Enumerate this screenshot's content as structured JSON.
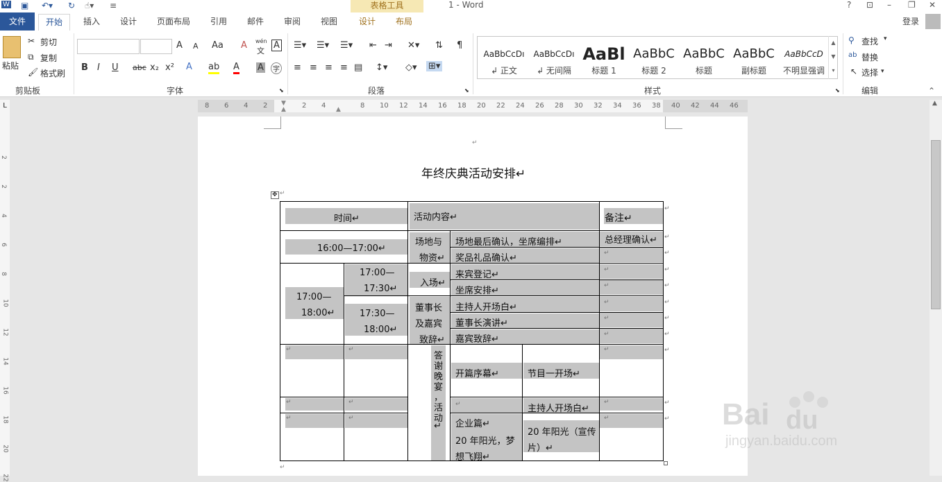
{
  "window": {
    "doc_title": "1 - Word",
    "contextual": "表格工具",
    "help": "?",
    "minimize": "–",
    "restore": "❐",
    "close": "✕",
    "login": "登录"
  },
  "tabs": {
    "file": "文件",
    "home": "开始",
    "insert": "插入",
    "design": "设计",
    "layout": "页面布局",
    "references": "引用",
    "mailings": "邮件",
    "review": "审阅",
    "view": "视图",
    "table_design": "设计",
    "table_layout": "布局"
  },
  "clipboard": {
    "paste": "粘贴",
    "cut": "剪切",
    "copy": "复制",
    "format_painter": "格式刷",
    "group": "剪贴板"
  },
  "font": {
    "grow": "A",
    "shrink": "A",
    "change_case": "Aa",
    "clear": "A",
    "phonetic_top": "wén",
    "phonetic": "文",
    "border_char": "A",
    "bold": "B",
    "italic": "I",
    "underline": "U",
    "strike": "abc",
    "sub": "x₂",
    "sup": "x²",
    "effect": "A",
    "highlight": "ab",
    "color": "A",
    "shade_char": "A",
    "enclose": "字",
    "group": "字体"
  },
  "paragraph": {
    "group": "段落"
  },
  "styles": {
    "items": [
      {
        "preview": "AaBbCcDı",
        "name": "↲ 正文"
      },
      {
        "preview": "AaBbCcDı",
        "name": "↲ 无间隔"
      },
      {
        "preview": "AaBl",
        "name": "标题 1"
      },
      {
        "preview": "AaBbC",
        "name": "标题 2"
      },
      {
        "preview": "AaBbC",
        "name": "标题"
      },
      {
        "preview": "AaBbC",
        "name": "副标题"
      },
      {
        "preview": "AaBbCcD",
        "name": "不明显强调"
      }
    ],
    "group": "样式"
  },
  "editing": {
    "find": "查找",
    "replace": "替换",
    "select": "选择",
    "group": "编辑"
  },
  "ruler": {
    "h": [
      "8",
      "6",
      "4",
      "2",
      "2",
      "4",
      "8",
      "10",
      "12",
      "14",
      "16",
      "18",
      "20",
      "22",
      "24",
      "26",
      "28",
      "30",
      "32",
      "34",
      "36",
      "38",
      "40",
      "42",
      "44",
      "46"
    ],
    "v": [
      "2",
      "2",
      "4",
      "6",
      "8",
      "10",
      "12",
      "14",
      "16",
      "18",
      "20",
      "22"
    ]
  },
  "document": {
    "blank_mark": "↵",
    "title": "年终庆典活动安排↵",
    "table": {
      "h_time": "时间↵",
      "h_content": "活动内容↵",
      "h_note": "备注↵",
      "t1": "16:00—17:00↵",
      "venue_a": "场地与",
      "venue_b": "物资↵",
      "c1": "场地最后确认，坐席编排↵",
      "n1": "总经理确认↵",
      "c2": "奖品礼品确认↵",
      "t2a": "17:00—",
      "t2b": "18:00↵",
      "t3a": "17:00—",
      "t3b": "17:30↵",
      "entry": "入场↵",
      "c3": "来宾登记↵",
      "c4": "坐席安排↵",
      "t4a": "17:30—",
      "t4b": "18:00↵",
      "chair_a": "董事长",
      "chair_b": "及嘉宾",
      "chair_c": "致辞↵",
      "c5": "主持人开场白↵",
      "c6": "董事长演讲↵",
      "c7": "嘉宾致辞↵",
      "dinner_v": [
        "答",
        "谢",
        "晚",
        "宴",
        "，",
        "活",
        "动",
        "↵"
      ],
      "c8": "开篇序幕↵",
      "c9": "节目一开场↵",
      "c10": "主持人开场白↵",
      "c11a": "企业篇↵",
      "c11b": "20 年阳光，梦",
      "c11c": "想飞翔↵",
      "c12a": "20 年阳光（宣传",
      "c12b": "片）↵",
      "empty": "↵"
    }
  }
}
